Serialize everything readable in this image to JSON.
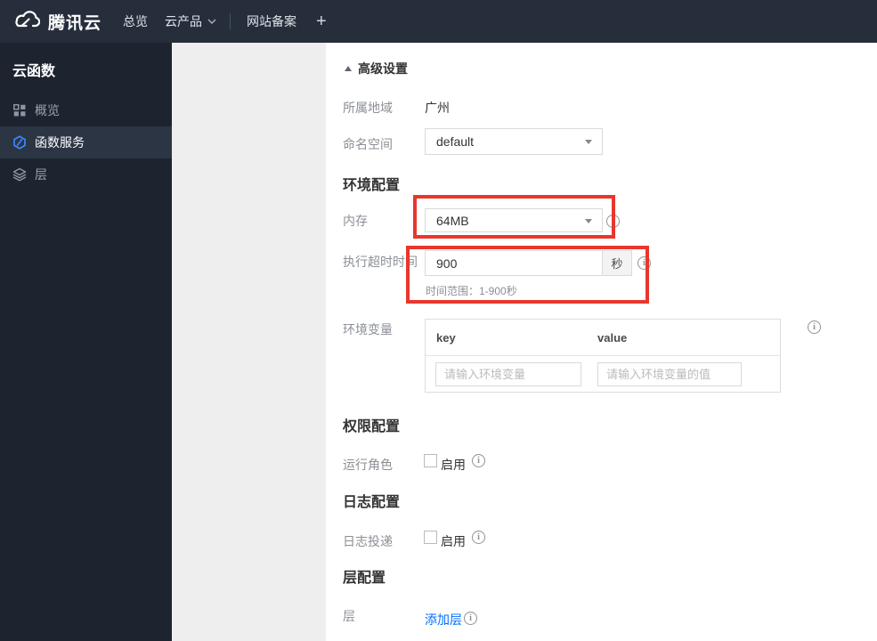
{
  "topbar": {
    "brand": "腾讯云",
    "nav_overview": "总览",
    "nav_products": "云产品",
    "nav_beian": "网站备案",
    "plus": "+"
  },
  "sidebar": {
    "title": "云函数",
    "items": [
      {
        "label": "概览",
        "icon": "grid-icon",
        "selected": false
      },
      {
        "label": "函数服务",
        "icon": "scf-hexagon-icon",
        "selected": true
      },
      {
        "label": "层",
        "icon": "layers-icon",
        "selected": false
      }
    ]
  },
  "content": {
    "advanced_toggle": "高级设置",
    "region": {
      "label": "所属地域",
      "value": "广州"
    },
    "namespace": {
      "label": "命名空间",
      "value": "default"
    },
    "section_env": "环境配置",
    "memory": {
      "label": "内存",
      "value": "64MB"
    },
    "timeout": {
      "label": "执行超时时间",
      "value": "900",
      "unit": "秒",
      "hint": "时间范围：1-900秒"
    },
    "env_vars": {
      "label": "环境变量",
      "col_key": "key",
      "col_value": "value",
      "key_placeholder": "请输入环境变量",
      "value_placeholder": "请输入环境变量的值"
    },
    "section_perm": "权限配置",
    "role": {
      "label": "运行角色",
      "enable": "启用",
      "checked": false
    },
    "section_log": "日志配置",
    "log_delivery": {
      "label": "日志投递",
      "enable": "启用",
      "checked": false
    },
    "section_layer": "层配置",
    "layer": {
      "label": "层",
      "add_link": "添加层"
    }
  },
  "colors": {
    "annotation_red": "#e7372d",
    "link_blue": "#006eff",
    "active_icon_blue": "#3b82f7",
    "topbar_bg": "#262e3c",
    "sidebar_bg": "#1d2430"
  }
}
